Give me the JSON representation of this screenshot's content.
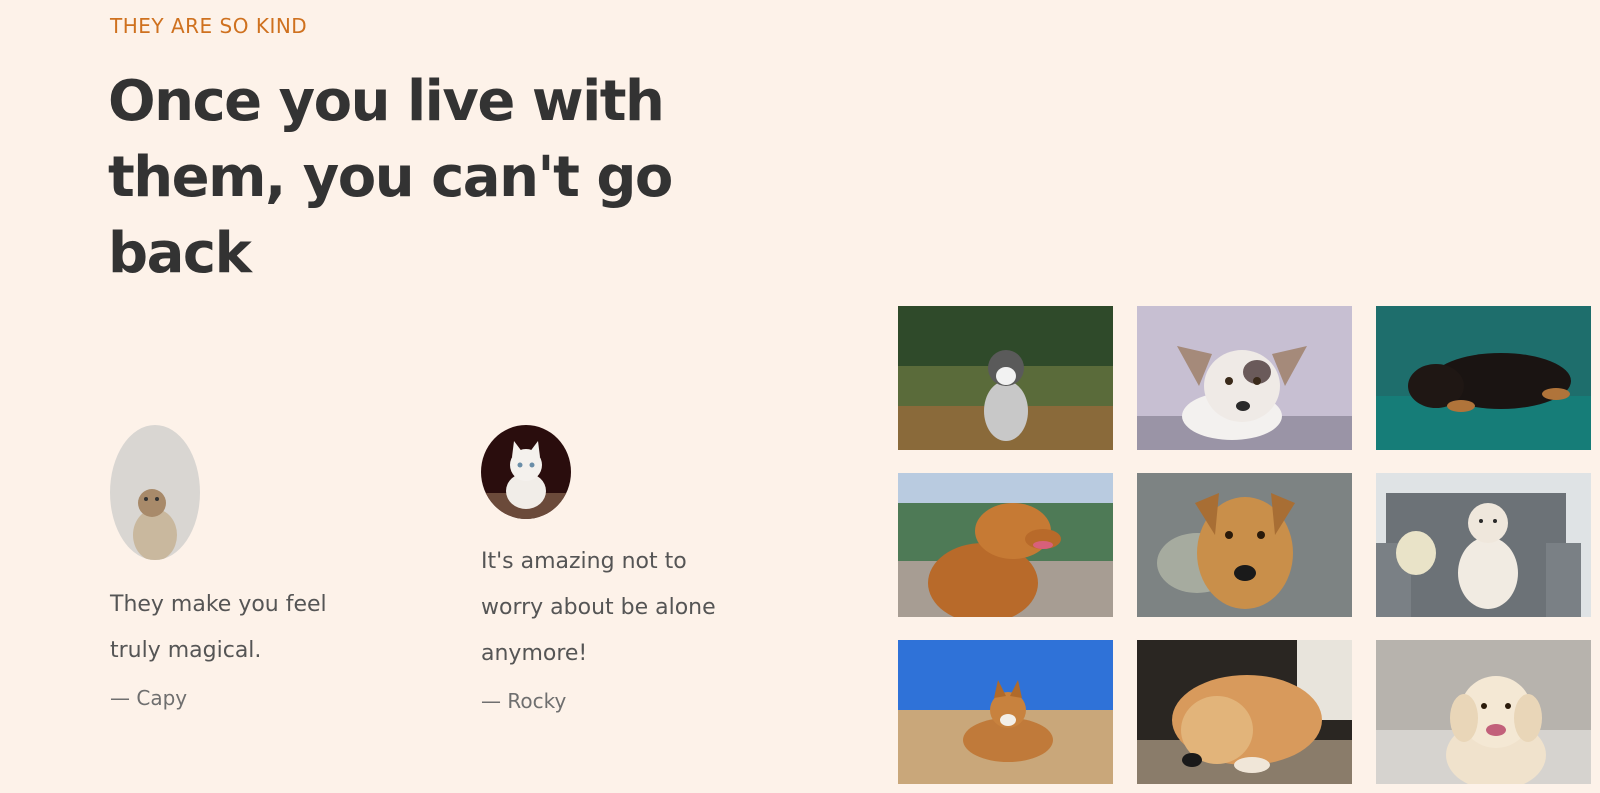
{
  "section": {
    "subheading": "They are so kind",
    "heading": "Once you live with them, you can't go back"
  },
  "testimonials": [
    {
      "quote": "They make you feel truly magical.",
      "author": "— Capy",
      "avatar_icon": "small-fluffy-dog-avatar"
    },
    {
      "quote": "It's amazing not to worry about be alone anymore!",
      "author": "— Rocky",
      "avatar_icon": "white-kitten-avatar"
    }
  ],
  "gallery": {
    "photos": [
      {
        "subject": "husky puppy in grass"
      },
      {
        "subject": "white dog lying with big ears"
      },
      {
        "subject": "black and tan dog on teal blanket"
      },
      {
        "subject": "golden retriever profile"
      },
      {
        "subject": "tan dog face close-up"
      },
      {
        "subject": "white poodle on grey armchair"
      },
      {
        "subject": "corgi on sandy beach"
      },
      {
        "subject": "golden dog lying on floor"
      },
      {
        "subject": "smiling golden retriever"
      }
    ]
  },
  "colors": {
    "background": "#fdf2e9",
    "accent": "#cf711f",
    "heading": "#333333"
  }
}
